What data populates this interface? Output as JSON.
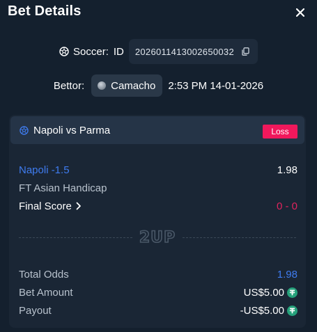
{
  "header": {
    "title": "Bet Details"
  },
  "bet_info": {
    "sport": "Soccer:",
    "id_label": "ID",
    "bet_id": "2026011413002650032",
    "bettor_label": "Bettor:",
    "bettor_name": "Camacho",
    "timestamp": "2:53 PM 14-01-2026"
  },
  "match": {
    "name": "Napoli vs Parma",
    "status": "Loss",
    "status_color": "#f0185c"
  },
  "selection": {
    "name": "Napoli -1.5",
    "odds": "1.98",
    "market": "FT Asian Handicap",
    "final_score_label": "Final Score",
    "final_score": "0 - 0"
  },
  "brand": {
    "logo_text": "2UP"
  },
  "summary": {
    "total_odds_label": "Total Odds",
    "total_odds": "1.98",
    "bet_amount_label": "Bet Amount",
    "bet_amount": "US$5.00",
    "payout_label": "Payout",
    "payout": "-US$5.00",
    "currency_icon": "tether-coin-icon"
  },
  "colors": {
    "accent_blue": "#3f7cf0",
    "loss_red": "#e0245e",
    "tether_green": "#26a17b"
  }
}
